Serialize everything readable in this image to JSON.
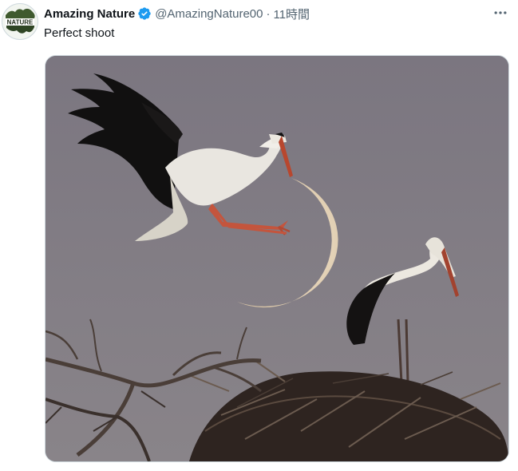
{
  "tweet": {
    "author_name": "Amazing Nature",
    "handle": "@AmazingNature00",
    "separator": "·",
    "time": "11時間",
    "text": "Perfect shoot",
    "verified": true,
    "verified_color": "#1d9bf0"
  },
  "avatar": {
    "logo_text": "NATURE"
  },
  "icons": {
    "more": "more-options-icon",
    "verified": "verified-badge-icon"
  }
}
